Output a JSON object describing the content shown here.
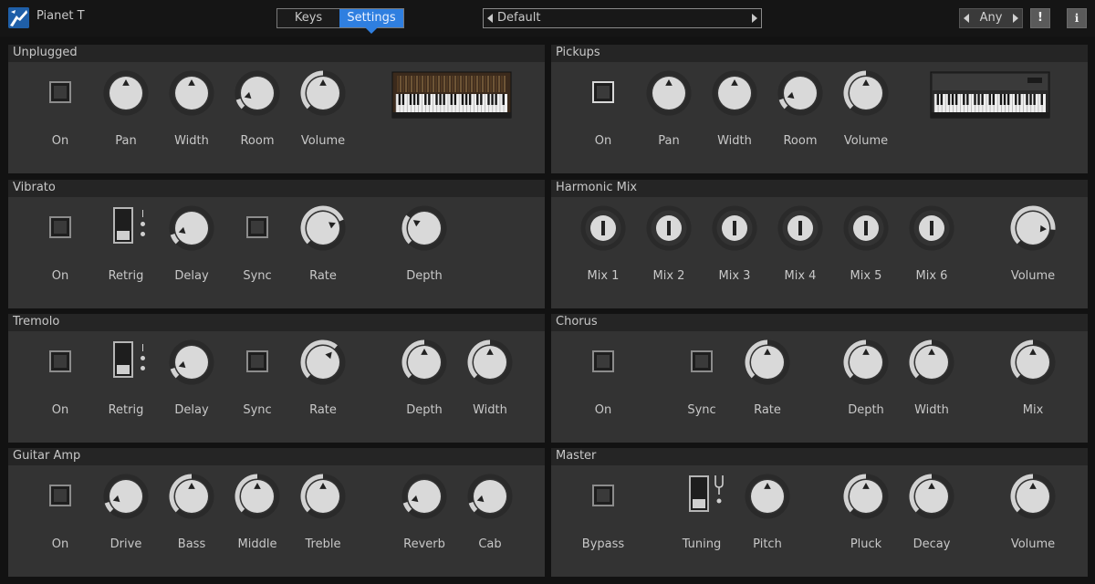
{
  "app": {
    "title": "Pianet T"
  },
  "tabs": [
    {
      "label": "Keys",
      "active": false
    },
    {
      "label": "Settings",
      "active": true
    }
  ],
  "preset": {
    "name": "Default"
  },
  "filter": {
    "label": "Any"
  },
  "buttons": {
    "alert": "!",
    "info": "i"
  },
  "colors": {
    "accent": "#2f7fe0",
    "panel": "#333333",
    "panel_header": "#252525",
    "background": "#121212"
  },
  "panels": {
    "unplugged": {
      "title": "Unplugged",
      "controls": [
        {
          "type": "check",
          "label": "On",
          "value": 0
        },
        {
          "type": "knob",
          "label": "Pan",
          "value": 0.5,
          "bipolar": true
        },
        {
          "type": "knob",
          "label": "Width",
          "value": 0.5,
          "bipolar": true
        },
        {
          "type": "knob",
          "label": "Room",
          "value": 0.1
        },
        {
          "type": "knob",
          "label": "Volume",
          "value": 0.5
        }
      ]
    },
    "pickups": {
      "title": "Pickups",
      "controls": [
        {
          "type": "check",
          "label": "On",
          "value": 1
        },
        {
          "type": "knob",
          "label": "Pan",
          "value": 0.5,
          "bipolar": true
        },
        {
          "type": "knob",
          "label": "Width",
          "value": 0.5,
          "bipolar": true
        },
        {
          "type": "knob",
          "label": "Room",
          "value": 0.1
        },
        {
          "type": "knob",
          "label": "Volume",
          "value": 0.5
        }
      ]
    },
    "vibrato": {
      "title": "Vibrato",
      "controls": [
        {
          "type": "check",
          "label": "On",
          "value": 0
        },
        {
          "type": "switch",
          "label": "Retrig",
          "value": 0
        },
        {
          "type": "knob",
          "label": "Delay",
          "value": 0.1
        },
        {
          "type": "check",
          "label": "Sync",
          "value": 0
        },
        {
          "type": "knob",
          "label": "Rate",
          "value": 0.75
        },
        {
          "type": "knob",
          "label": "Depth",
          "value": 0.3
        }
      ]
    },
    "harmonic_mix": {
      "title": "Harmonic Mix",
      "controls": [
        {
          "type": "bar",
          "label": "Mix 1",
          "value": 0
        },
        {
          "type": "bar",
          "label": "Mix 2",
          "value": 0
        },
        {
          "type": "bar",
          "label": "Mix 3",
          "value": 0
        },
        {
          "type": "bar",
          "label": "Mix 4",
          "value": 0
        },
        {
          "type": "bar",
          "label": "Mix 5",
          "value": 0
        },
        {
          "type": "bar",
          "label": "Mix 6",
          "value": 0
        },
        {
          "type": "knob",
          "label": "Volume",
          "value": 0.85
        }
      ]
    },
    "tremolo": {
      "title": "Tremolo",
      "controls": [
        {
          "type": "check",
          "label": "On",
          "value": 0
        },
        {
          "type": "switch",
          "label": "Retrig",
          "value": 0
        },
        {
          "type": "knob",
          "label": "Delay",
          "value": 0.1
        },
        {
          "type": "check",
          "label": "Sync",
          "value": 0
        },
        {
          "type": "knob",
          "label": "Rate",
          "value": 0.65
        },
        {
          "type": "knob",
          "label": "Depth",
          "value": 0.5
        },
        {
          "type": "knob",
          "label": "Width",
          "value": 0.5
        }
      ]
    },
    "chorus": {
      "title": "Chorus",
      "controls": [
        {
          "type": "check",
          "label": "On",
          "value": 0
        },
        {
          "type": "check",
          "label": "Sync",
          "value": 0
        },
        {
          "type": "knob",
          "label": "Rate",
          "value": 0.5
        },
        {
          "type": "knob",
          "label": "Depth",
          "value": 0.5
        },
        {
          "type": "knob",
          "label": "Width",
          "value": 0.5
        },
        {
          "type": "knob",
          "label": "Mix",
          "value": 0.5
        }
      ]
    },
    "guitar_amp": {
      "title": "Guitar Amp",
      "controls": [
        {
          "type": "check",
          "label": "On",
          "value": 0
        },
        {
          "type": "knob",
          "label": "Drive",
          "value": 0.1
        },
        {
          "type": "knob",
          "label": "Bass",
          "value": 0.5
        },
        {
          "type": "knob",
          "label": "Middle",
          "value": 0.5
        },
        {
          "type": "knob",
          "label": "Treble",
          "value": 0.5
        },
        {
          "type": "knob",
          "label": "Reverb",
          "value": 0.1
        },
        {
          "type": "knob",
          "label": "Cab",
          "value": 0.1
        }
      ]
    },
    "master": {
      "title": "Master",
      "controls": [
        {
          "type": "check",
          "label": "Bypass",
          "value": 0
        },
        {
          "type": "switch",
          "label": "Tuning",
          "value": 0,
          "tuner": true
        },
        {
          "type": "knob",
          "label": "Pitch",
          "value": 0.5,
          "bipolar": true
        },
        {
          "type": "knob",
          "label": "Pluck",
          "value": 0.5
        },
        {
          "type": "knob",
          "label": "Decay",
          "value": 0.5
        },
        {
          "type": "knob",
          "label": "Volume",
          "value": 0.5
        }
      ]
    }
  }
}
